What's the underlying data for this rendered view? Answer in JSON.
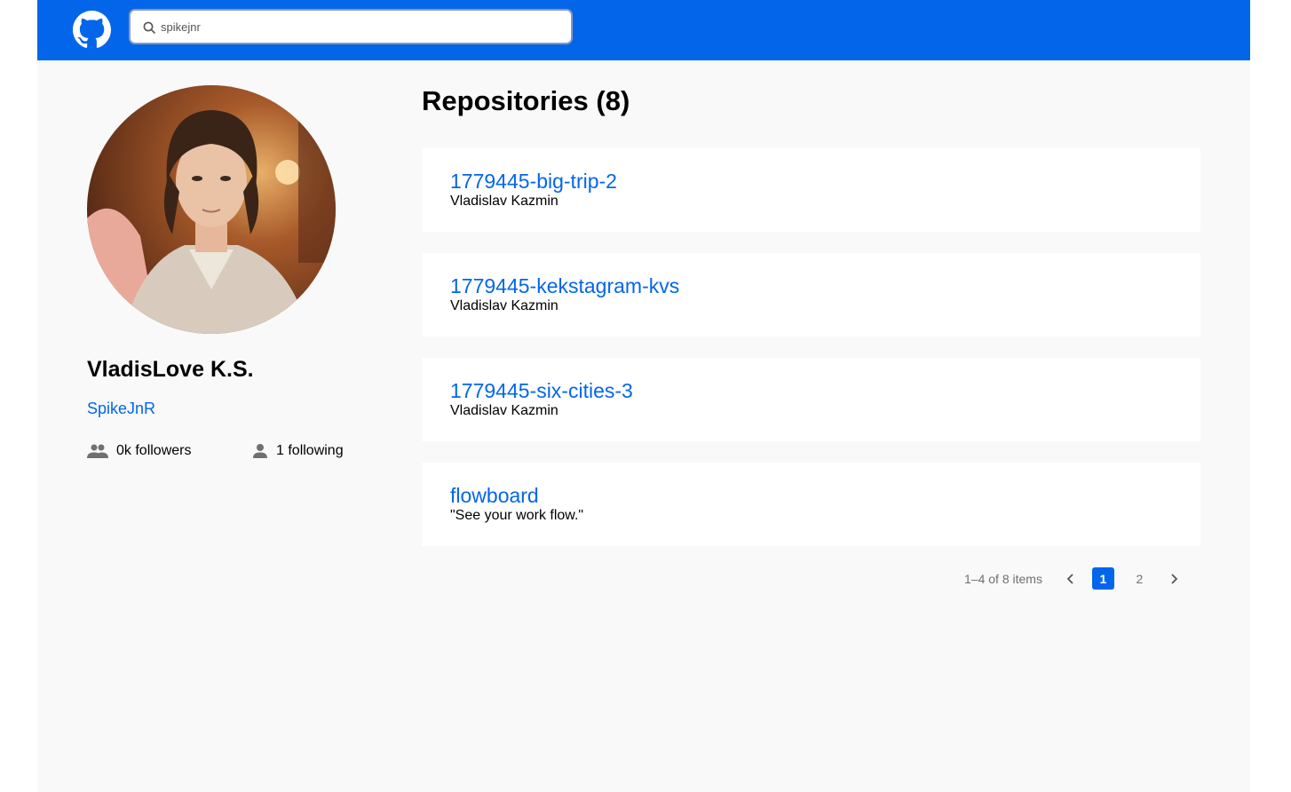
{
  "header": {
    "logo_icon": "github-logo-icon",
    "search_icon": "search-icon",
    "search_value": "spikejnr"
  },
  "profile": {
    "name": "VladisLove K.S.",
    "login": "SpikeJnR",
    "followers_icon": "people-icon",
    "followers": "0k followers",
    "following_icon": "person-icon",
    "following": "1 following"
  },
  "repositories": {
    "title": "Repositories (8)",
    "items": [
      {
        "name": "1779445-big-trip-2",
        "description": "Vladislav Kazmin"
      },
      {
        "name": "1779445-kekstagram-kvs",
        "description": "Vladislav Kazmin"
      },
      {
        "name": "1779445-six-cities-3",
        "description": "Vladislav Kazmin"
      },
      {
        "name": "flowboard",
        "description": "\"See your work flow.\""
      }
    ]
  },
  "pagination": {
    "range": "1–4 of 8 items",
    "pages": [
      "1",
      "2"
    ],
    "current": "1",
    "prev_icon": "chevron-left-icon",
    "next_icon": "chevron-right-icon"
  },
  "colors": {
    "accent": "#0366ea",
    "page_background": "#f9f9f9"
  }
}
